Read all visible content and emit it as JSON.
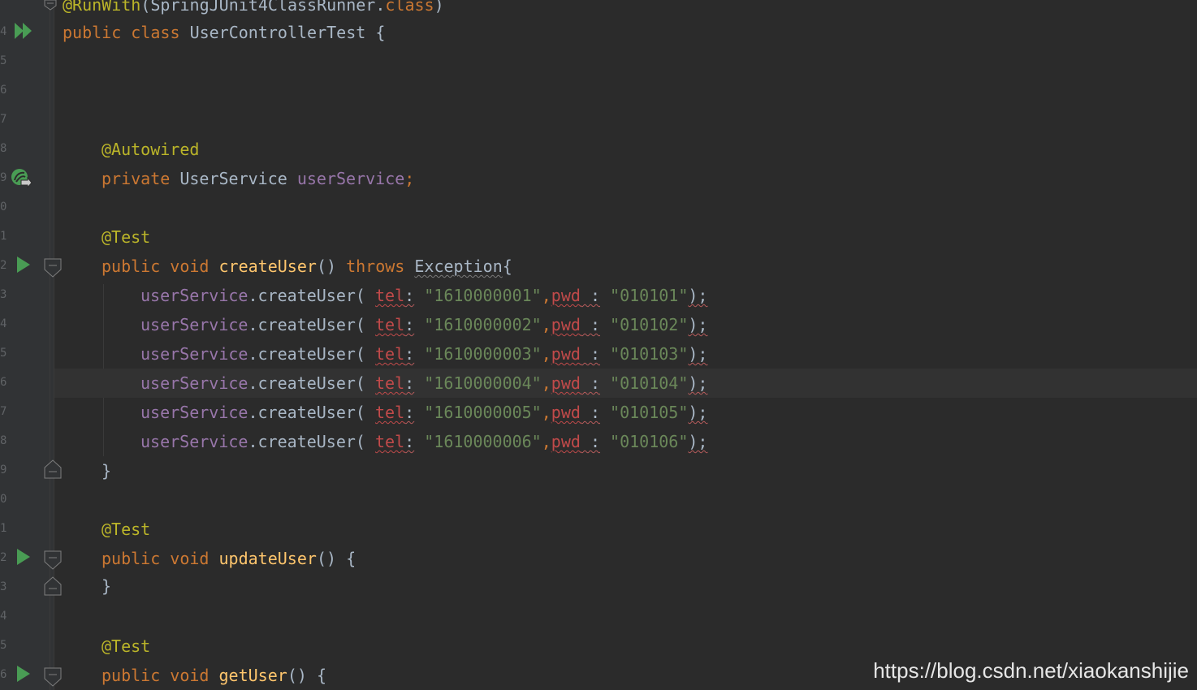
{
  "gutter": {
    "line_number_fragments": [
      "4",
      "5",
      "6",
      "7",
      "8",
      "9",
      "0",
      "1",
      "2",
      "3",
      "4",
      "5",
      "6",
      "7",
      "8",
      "9",
      "0",
      "1",
      "2",
      "3",
      "4",
      "5",
      "6"
    ]
  },
  "code": {
    "annotation_runwith": "@RunWith",
    "runner_open": "(SpringJUnit4ClassRunner.",
    "class_kw": "class",
    "runner_close": ")",
    "kw_public": "public",
    "kw_class": "class",
    "class_name": "UserControllerTest",
    "open_brace": "{",
    "annotation_autowired": "@Autowired",
    "kw_private": "private",
    "type_userservice": "UserService",
    "field_userservice": "userService",
    "semicolon": ";",
    "annotation_test": "@Test",
    "kw_void": "void",
    "method_create": "createUser",
    "parens": "()",
    "kw_throws": "throws",
    "exception_type": "Exception",
    "close_brace": "}",
    "method_update": "updateUser",
    "method_get": "getUser",
    "call_method": "createUser",
    "hint_tel": "tel",
    "hint_pwd": "pwd",
    "calls": [
      {
        "tel": "\"1610000001\"",
        "pwd": "\"010101\""
      },
      {
        "tel": "\"1610000002\"",
        "pwd": "\"010102\""
      },
      {
        "tel": "\"1610000003\"",
        "pwd": "\"010103\""
      },
      {
        "tel": "\"1610000004\"",
        "pwd": "\"010104\""
      },
      {
        "tel": "\"1610000005\"",
        "pwd": "\"010105\""
      },
      {
        "tel": "\"1610000006\"",
        "pwd": "\"010106\""
      }
    ]
  },
  "watermark": "https://blog.csdn.net/xiaokanshijie",
  "colors": {
    "background": "#2b2b2b",
    "gutter": "#313335",
    "keyword": "#cc7832",
    "annotation": "#bbb529",
    "field": "#9876aa",
    "method": "#ffc66d",
    "string": "#6a8759",
    "param_hint": "#c14a4a",
    "run_icon": "#499c54"
  },
  "icons": [
    "run-class-icon",
    "autowired-bean-icon",
    "run-test-icon",
    "fold-start-icon",
    "fold-end-icon"
  ]
}
